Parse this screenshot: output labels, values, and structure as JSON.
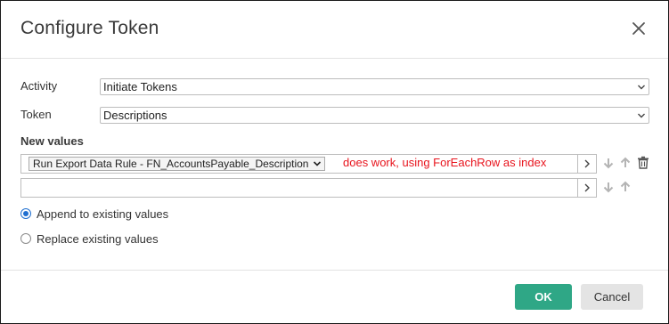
{
  "dialog": {
    "title": "Configure Token",
    "close_icon": "close-icon"
  },
  "activity": {
    "label": "Activity",
    "value": "Initiate Tokens"
  },
  "token": {
    "label": "Token",
    "value": "Descriptions"
  },
  "new_values": {
    "title": "New values",
    "rows": [
      {
        "pill": "Run Export Data Rule - FN_AccountsPayable_Description",
        "value": ""
      },
      {
        "pill": "",
        "value": ""
      }
    ],
    "annotation": "does work, using ForEachRow as index"
  },
  "options": {
    "append_label": "Append to existing values",
    "replace_label": "Replace existing values",
    "selected": "append"
  },
  "footer": {
    "ok_label": "OK",
    "cancel_label": "Cancel"
  },
  "colors": {
    "accent": "#2fa786",
    "radio": "#1f6fd0",
    "annotation": "#e8141d"
  }
}
